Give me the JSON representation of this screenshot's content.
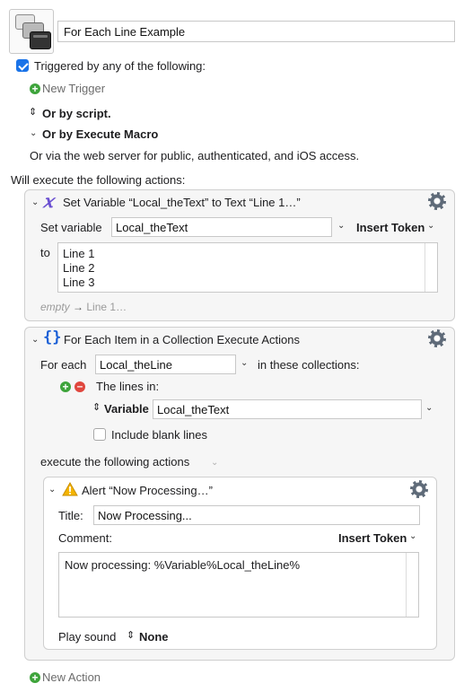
{
  "macro": {
    "icon": "stacked-windows-icon",
    "name": "For Each Line Example"
  },
  "triggers": {
    "label": "Triggered by any of the following:",
    "checked": true,
    "new_trigger": "New Trigger",
    "or_script": "Or by script.",
    "or_execute_macro": "Or by Execute Macro",
    "web_server": "Or via the web server for public, authenticated, and iOS access."
  },
  "will_execute": "Will execute the following actions:",
  "set_variable": {
    "title": "Set Variable “Local_theText” to Text “Line 1…”",
    "set_variable_label": "Set variable",
    "variable_name": "Local_theText",
    "insert_token": "Insert Token",
    "to_label": "to",
    "lines": [
      "Line 1",
      "Line 2",
      "Line 3"
    ],
    "preview_empty": "empty",
    "preview_arrow": "→",
    "preview_value": "Line 1…"
  },
  "for_each": {
    "title": "For Each Item in a Collection Execute Actions",
    "for_each_label": "For each",
    "variable": "Local_theLine",
    "in_collections": "in these collections:",
    "lines_in": "The lines in:",
    "variable_type": "Variable",
    "variable_value": "Local_theText",
    "include_blank": "Include blank lines",
    "include_blank_checked": false,
    "execute_label": "execute the following actions"
  },
  "alert": {
    "title": "Alert “Now Processing…”",
    "title_label": "Title:",
    "title_value": "Now Processing...",
    "comment_label": "Comment:",
    "insert_token": "Insert Token",
    "comment_text": "Now processing: %Variable%Local_theLine%",
    "play_sound_label": "Play sound",
    "sound_value": "None"
  },
  "new_action": "New Action",
  "colors": {
    "accent": "#1a73e8",
    "add_green": "#3ea43b",
    "remove_red": "#e0473e",
    "variable_icon": "#6a4fd1",
    "warning": "#f4b400"
  }
}
